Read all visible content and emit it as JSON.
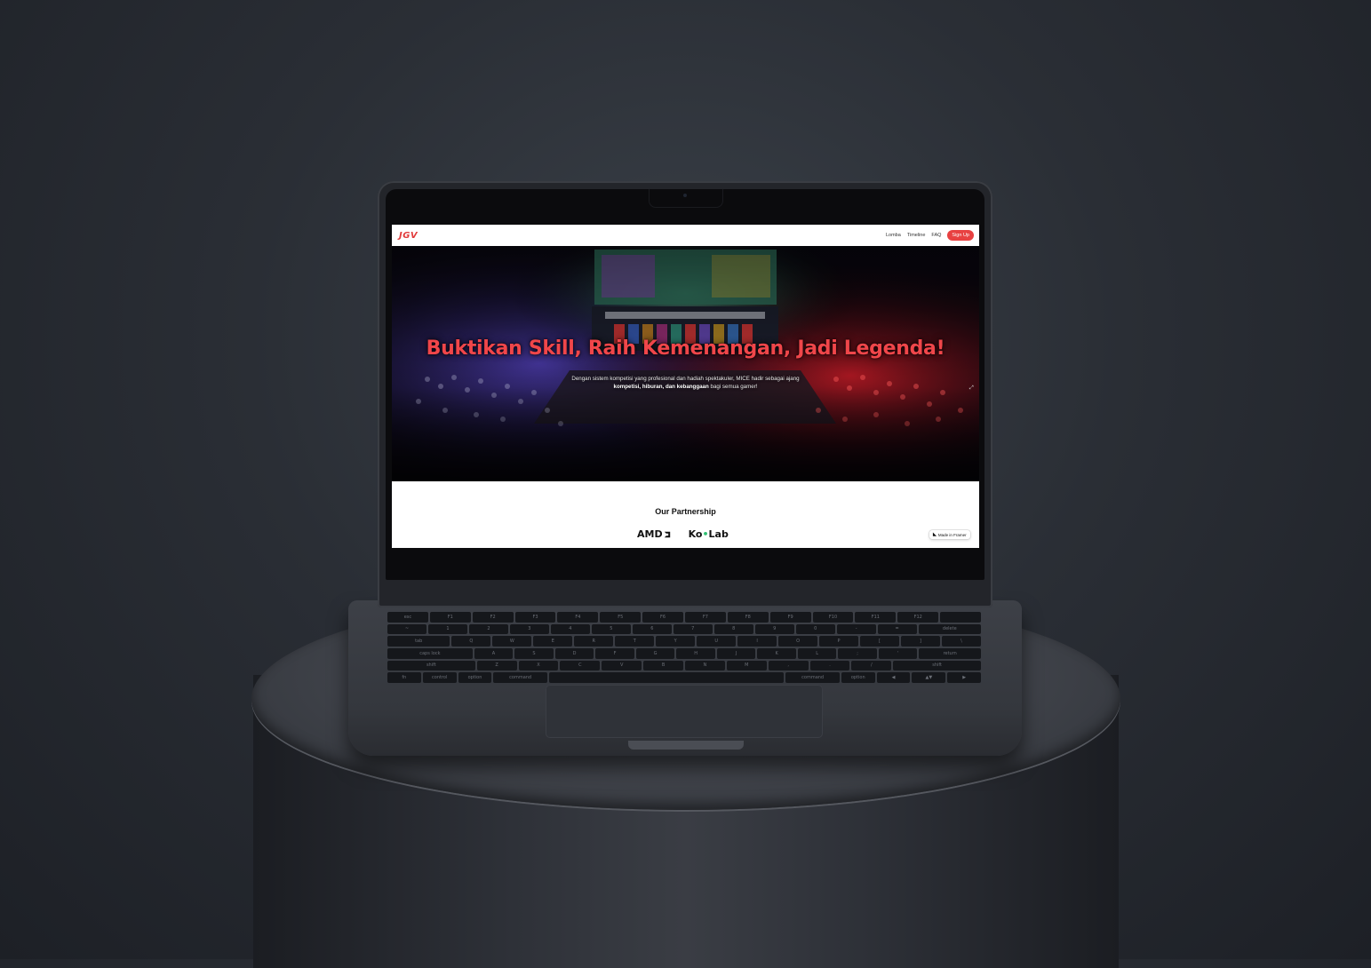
{
  "nav": {
    "logo": "JGV",
    "links": [
      "Lomba",
      "Timeline",
      "FAQ"
    ],
    "signup": "Sign Up"
  },
  "hero": {
    "title": "Buktikan Skill, Raih Kemenangan, Jadi Legenda!",
    "subtitle_line1": "Dengan sistem kompetisi yang profesional dan hadiah spektakuler, MICE hadir sebagai ajang",
    "subtitle_bold": "kompetisi, hiburan, dan kebanggaan",
    "subtitle_end": "bagi semua gamer!"
  },
  "partners": {
    "title": "Our Partnership",
    "amd": "AMD",
    "kolab_left": "Ko",
    "kolab_dot": "•",
    "kolab_right": "Lab"
  },
  "framer_badge": "Made in Framer",
  "colors": {
    "accent": "#e84141",
    "title_red": "#f0464a",
    "kolab_green": "#2fbf71"
  },
  "keyboard": {
    "rows": [
      [
        "esc",
        "F1",
        "F2",
        "F3",
        "F4",
        "F5",
        "F6",
        "F7",
        "F8",
        "F9",
        "F10",
        "F11",
        "F12",
        ""
      ],
      [
        "~",
        "1",
        "2",
        "3",
        "4",
        "5",
        "6",
        "7",
        "8",
        "9",
        "0",
        "-",
        "=",
        "delete"
      ],
      [
        "tab",
        "Q",
        "W",
        "E",
        "R",
        "T",
        "Y",
        "U",
        "I",
        "O",
        "P",
        "[",
        "]",
        "\\"
      ],
      [
        "caps lock",
        "A",
        "S",
        "D",
        "F",
        "G",
        "H",
        "J",
        "K",
        "L",
        ";",
        "'",
        "return"
      ],
      [
        "shift",
        "Z",
        "X",
        "C",
        "V",
        "B",
        "N",
        "M",
        ",",
        ".",
        "/",
        "shift"
      ],
      [
        "fn",
        "control",
        "option",
        "command",
        "",
        "command",
        "option",
        "◀",
        "▲▼",
        "▶"
      ]
    ]
  }
}
